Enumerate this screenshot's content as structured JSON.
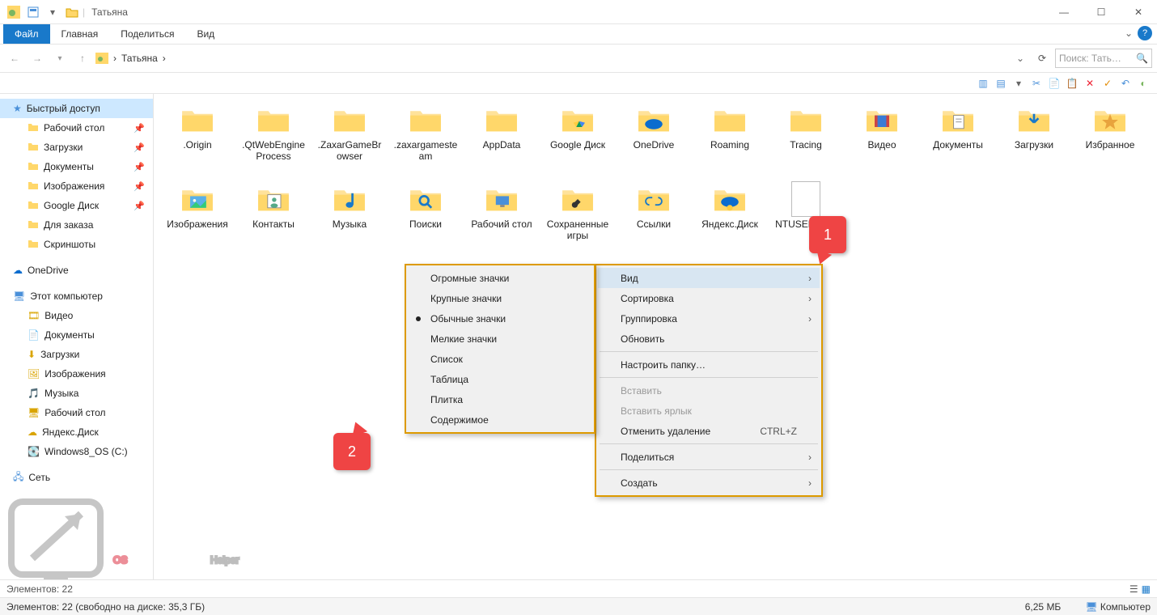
{
  "window": {
    "title": "Татьяна"
  },
  "ribbon": {
    "file": "Файл",
    "tabs": [
      "Главная",
      "Поделиться",
      "Вид"
    ]
  },
  "breadcrumb": {
    "root": "Татьяна",
    "sep": "›"
  },
  "search": {
    "placeholder": "Поиск: Тать…"
  },
  "sidebar": {
    "quick": "Быстрый доступ",
    "quick_items": [
      {
        "label": "Рабочий стол",
        "pin": true
      },
      {
        "label": "Загрузки",
        "pin": true
      },
      {
        "label": "Документы",
        "pin": true
      },
      {
        "label": "Изображения",
        "pin": true
      },
      {
        "label": "Google Диск",
        "pin": true
      },
      {
        "label": "Для заказа",
        "pin": false
      },
      {
        "label": "Скриншоты",
        "pin": false
      }
    ],
    "onedrive": "OneDrive",
    "thispc": "Этот компьютер",
    "pc_items": [
      "Видео",
      "Документы",
      "Загрузки",
      "Изображения",
      "Музыка",
      "Рабочий стол",
      "Яндекс.Диск",
      "Windows8_OS (C:)"
    ],
    "network": "Сеть"
  },
  "items": [
    {
      "name": ".Origin",
      "type": "folder"
    },
    {
      "name": ".QtWebEngineProcess",
      "type": "folder"
    },
    {
      "name": ".ZaxarGameBrowser",
      "type": "folder"
    },
    {
      "name": ".zaxargamesteam",
      "type": "folder"
    },
    {
      "name": "AppData",
      "type": "folder"
    },
    {
      "name": "Google Диск",
      "type": "gdrive"
    },
    {
      "name": "OneDrive",
      "type": "onedrive"
    },
    {
      "name": "Roaming",
      "type": "folder"
    },
    {
      "name": "Tracing",
      "type": "folder"
    },
    {
      "name": "Видео",
      "type": "video"
    },
    {
      "name": "Документы",
      "type": "docs"
    },
    {
      "name": "Загрузки",
      "type": "downloads"
    },
    {
      "name": "Избранное",
      "type": "favorites"
    },
    {
      "name": "Изображения",
      "type": "pictures"
    },
    {
      "name": "Контакты",
      "type": "contacts"
    },
    {
      "name": "Музыка",
      "type": "music"
    },
    {
      "name": "Поиски",
      "type": "search"
    },
    {
      "name": "Рабочий стол",
      "type": "desktop"
    },
    {
      "name": "Сохраненные игры",
      "type": "games"
    },
    {
      "name": "Ссылки",
      "type": "links"
    },
    {
      "name": "Яндекс.Диск",
      "type": "yadisk"
    },
    {
      "name": "NTUSER.DAT",
      "type": "file"
    }
  ],
  "context_menu": {
    "view": "Вид",
    "sort": "Сортировка",
    "group": "Группировка",
    "refresh": "Обновить",
    "customize": "Настроить папку…",
    "paste": "Вставить",
    "paste_shortcut": "Вставить ярлык",
    "undo_delete": "Отменить удаление",
    "undo_shortcut": "CTRL+Z",
    "share": "Поделиться",
    "create": "Создать"
  },
  "view_submenu": {
    "huge": "Огромные значки",
    "large": "Крупные значки",
    "medium": "Обычные значки",
    "small": "Мелкие значки",
    "list": "Список",
    "table": "Таблица",
    "tiles": "Плитка",
    "content": "Содержимое"
  },
  "status": {
    "count": "Элементов: 22",
    "long": "Элементов: 22 (свободно на диске: 35,3 ГБ)",
    "size": "6,25 МБ",
    "computer": "Компьютер"
  },
  "badges": {
    "b1": "1",
    "b2": "2"
  },
  "watermark": "OS Helper"
}
